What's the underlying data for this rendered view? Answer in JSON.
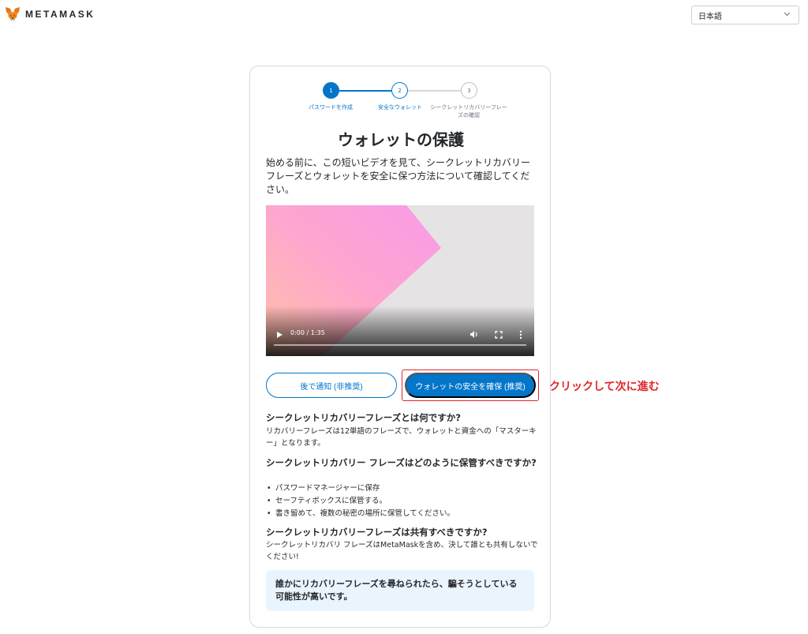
{
  "header": {
    "logo_text": "METAMASK",
    "language": {
      "selected": "日本語"
    }
  },
  "stepper": {
    "steps": [
      {
        "number": "1",
        "label": "パスワードを作成"
      },
      {
        "number": "2",
        "label": "安全なウォレット"
      },
      {
        "number": "3",
        "label": "シークレットリカバリーフレーズの確認"
      }
    ]
  },
  "main": {
    "title": "ウォレットの保護",
    "intro": "始める前に、この短いビデオを見て、シークレットリカバリーフレーズとウォレットを安全に保つ方法について確認してください。",
    "video": {
      "time": "0:00 / 1:35",
      "progress": 0
    },
    "buttons": {
      "remind_later": "後で通知 (非推奨)",
      "secure_wallet": "ウォレットの安全を確保 (推奨)"
    },
    "annotation": "クリックして次に進む",
    "faq": [
      {
        "question": "シークレットリカバリーフレーズとは何ですか?",
        "answer": "リカバリーフレーズは12単語のフレーズで、ウォレットと資金への「マスターキー」となります。"
      },
      {
        "question": "シークレットリカバリー フレーズはどのように保管すべきですか?",
        "items": [
          "パスワードマネージャーに保存",
          "セーフティボックスに保管する。",
          "書き留めて、複数の秘密の場所に保管してください。"
        ]
      },
      {
        "question": "シークレットリカバリーフレーズは共有すべきですか?",
        "answer": "シークレットリカバリ フレーズはMetaMaskを含め、決して誰とも共有しないでください!"
      }
    ],
    "warning": "誰かにリカバリーフレーズを尋ねられたら、騙そうとしている可能性が高いです。"
  },
  "colors": {
    "primary": "#0376c9",
    "annotation": "#e0262b",
    "warning_bg": "#eaf4fc"
  }
}
